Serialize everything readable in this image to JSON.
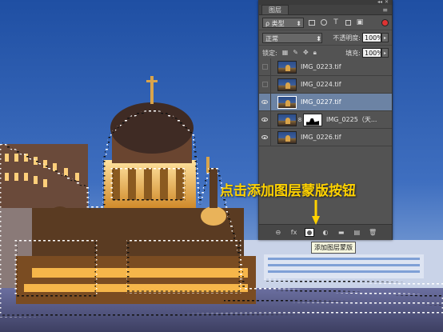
{
  "panel": {
    "tab_label": "图层",
    "filter": {
      "value": "ρ 类型"
    },
    "blend_mode": {
      "value": "正常"
    },
    "opacity": {
      "label": "不透明度:",
      "value": "100%"
    },
    "lock_label": "锁定:",
    "fill": {
      "label": "填充:",
      "value": "100%"
    }
  },
  "layers": [
    {
      "name": "IMG_0223.tif",
      "visible": false,
      "selected": false,
      "has_mask": false
    },
    {
      "name": "IMG_0224.tif",
      "visible": false,
      "selected": false,
      "has_mask": false
    },
    {
      "name": "IMG_0227.tif",
      "visible": true,
      "selected": true,
      "has_mask": false
    },
    {
      "name": "IMG_0225（天...",
      "visible": true,
      "selected": false,
      "has_mask": true
    },
    {
      "name": "IMG_0226.tif",
      "visible": true,
      "selected": false,
      "has_mask": false
    }
  ],
  "bottom_bar": {
    "fx_label": "fx",
    "icons": [
      "link-layers-icon",
      "fx-icon",
      "add-layer-mask-icon",
      "adjustment-layer-icon",
      "new-group-icon",
      "new-layer-icon",
      "trash-icon"
    ]
  },
  "annotation": {
    "instruction": "点击添加图层蒙版按钮",
    "tooltip": "添加图层蒙版",
    "color": "#ffd200"
  },
  "colors": {
    "selected_layer": "#6c83a4",
    "panel_bg": "#535353"
  }
}
